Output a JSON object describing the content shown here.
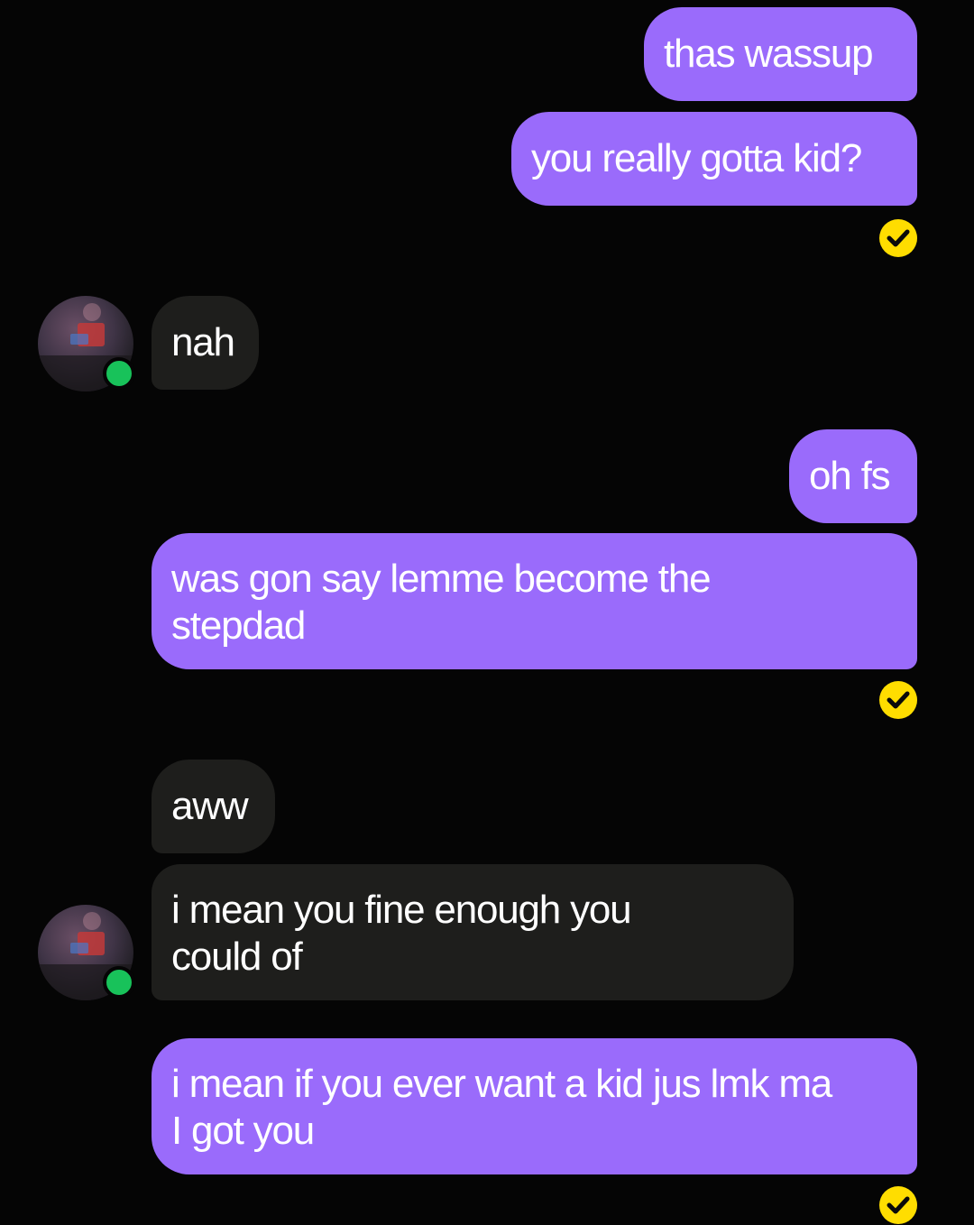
{
  "colors": {
    "background": "#050505",
    "outgoing_bubble": "#9a6bfb",
    "incoming_bubble": "#1e1e1c",
    "read_check": "#ffdd00",
    "online_dot": "#18c25a"
  },
  "messages": [
    {
      "direction": "outgoing",
      "lines": [
        "thas wassup"
      ]
    },
    {
      "direction": "outgoing",
      "lines": [
        "you really gotta kid?"
      ],
      "read_icon": "check-circle-icon"
    },
    {
      "direction": "incoming",
      "lines": [
        "nah"
      ],
      "avatar": "avatar-icon"
    },
    {
      "direction": "outgoing",
      "lines": [
        "oh fs"
      ]
    },
    {
      "direction": "outgoing",
      "lines": [
        "was gon say lemme become the",
        "stepdad"
      ],
      "read_icon": "check-circle-icon"
    },
    {
      "direction": "incoming",
      "lines": [
        "aww"
      ]
    },
    {
      "direction": "incoming",
      "lines": [
        "i mean you fine enough you",
        "could of"
      ],
      "avatar": "avatar-icon"
    },
    {
      "direction": "outgoing",
      "lines": [
        "i mean if you ever want a kid jus lmk ma",
        "I got you"
      ],
      "read_icon": "check-circle-icon"
    }
  ]
}
